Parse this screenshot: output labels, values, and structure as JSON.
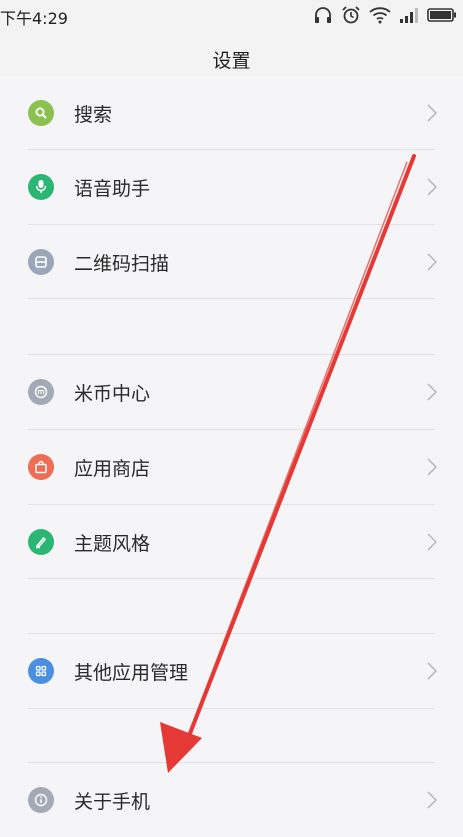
{
  "status_bar": {
    "time": "下午4:29",
    "icons": [
      "headphones-icon",
      "alarm-icon",
      "wifi-icon",
      "signal-icon",
      "battery-icon"
    ]
  },
  "header": {
    "title": "设置"
  },
  "settings": {
    "items": [
      {
        "label": "搜索",
        "icon": "search-icon",
        "color": "#8cc152"
      },
      {
        "label": "语音助手",
        "icon": "microphone-icon",
        "color": "#2bb673"
      },
      {
        "label": "二维码扫描",
        "icon": "qr-scan-icon",
        "color": "#9aa7b8"
      },
      {
        "label": "米币中心",
        "icon": "mi-coin-icon",
        "color": "#a3aab5"
      },
      {
        "label": "应用商店",
        "icon": "shopping-bag-icon",
        "color": "#ef6c57"
      },
      {
        "label": "主题风格",
        "icon": "brush-icon",
        "color": "#2bb673"
      },
      {
        "label": "其他应用管理",
        "icon": "apps-grid-icon",
        "color": "#4a8fe0"
      },
      {
        "label": "关于手机",
        "icon": "info-icon",
        "color": "#a3aab5"
      }
    ]
  },
  "colors": {
    "annotation_arrow": "#e53935",
    "chevron": "#b5b5b8"
  }
}
